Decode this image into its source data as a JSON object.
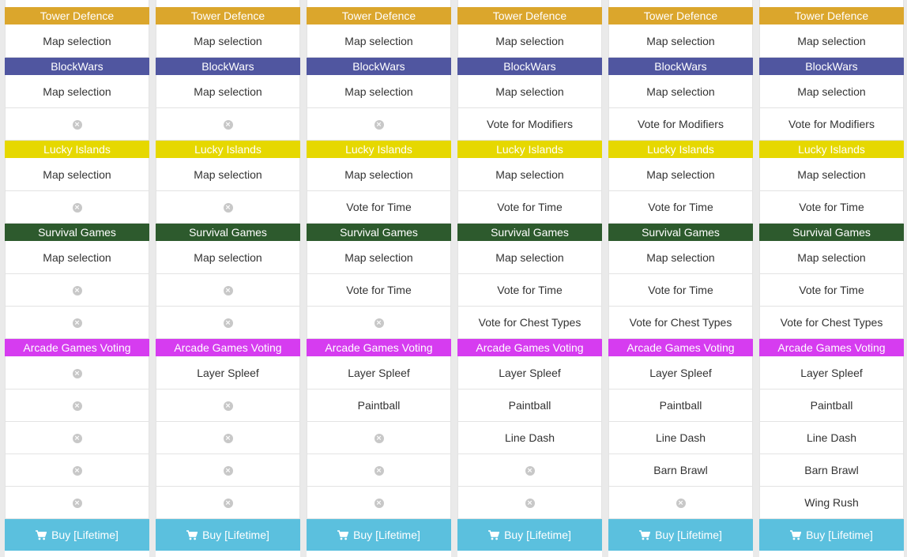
{
  "colors": {
    "tower_defence": "#dba62c",
    "blockwars": "#5056a0",
    "lucky_islands": "#e6d800",
    "survival_games": "#2d5a2d",
    "arcade_games_voting": "#d63cf0",
    "buy": "#5bc0de"
  },
  "buy_label": "Buy [Lifetime]",
  "columns": [
    {
      "tower_defence": {
        "title": "Tower Defence",
        "cells": [
          "Map selection"
        ]
      },
      "blockwars": {
        "title": "BlockWars",
        "cells": [
          "Map selection",
          null
        ]
      },
      "lucky_islands": {
        "title": "Lucky Islands",
        "cells": [
          "Map selection",
          null
        ]
      },
      "survival_games": {
        "title": "Survival Games",
        "cells": [
          "Map selection",
          null,
          null
        ]
      },
      "arcade_games_voting": {
        "title": "Arcade Games Voting",
        "cells": [
          null,
          null,
          null,
          null,
          null
        ]
      }
    },
    {
      "tower_defence": {
        "title": "Tower Defence",
        "cells": [
          "Map selection"
        ]
      },
      "blockwars": {
        "title": "BlockWars",
        "cells": [
          "Map selection",
          null
        ]
      },
      "lucky_islands": {
        "title": "Lucky Islands",
        "cells": [
          "Map selection",
          null
        ]
      },
      "survival_games": {
        "title": "Survival Games",
        "cells": [
          "Map selection",
          null,
          null
        ]
      },
      "arcade_games_voting": {
        "title": "Arcade Games Voting",
        "cells": [
          "Layer Spleef",
          null,
          null,
          null,
          null
        ]
      }
    },
    {
      "tower_defence": {
        "title": "Tower Defence",
        "cells": [
          "Map selection"
        ]
      },
      "blockwars": {
        "title": "BlockWars",
        "cells": [
          "Map selection",
          null
        ]
      },
      "lucky_islands": {
        "title": "Lucky Islands",
        "cells": [
          "Map selection",
          "Vote for Time"
        ]
      },
      "survival_games": {
        "title": "Survival Games",
        "cells": [
          "Map selection",
          "Vote for Time",
          null
        ]
      },
      "arcade_games_voting": {
        "title": "Arcade Games Voting",
        "cells": [
          "Layer Spleef",
          "Paintball",
          null,
          null,
          null
        ]
      }
    },
    {
      "tower_defence": {
        "title": "Tower Defence",
        "cells": [
          "Map selection"
        ]
      },
      "blockwars": {
        "title": "BlockWars",
        "cells": [
          "Map selection",
          "Vote for Modifiers"
        ]
      },
      "lucky_islands": {
        "title": "Lucky Islands",
        "cells": [
          "Map selection",
          "Vote for Time"
        ]
      },
      "survival_games": {
        "title": "Survival Games",
        "cells": [
          "Map selection",
          "Vote for Time",
          "Vote for Chest Types"
        ]
      },
      "arcade_games_voting": {
        "title": "Arcade Games Voting",
        "cells": [
          "Layer Spleef",
          "Paintball",
          "Line Dash",
          null,
          null
        ]
      }
    },
    {
      "tower_defence": {
        "title": "Tower Defence",
        "cells": [
          "Map selection"
        ]
      },
      "blockwars": {
        "title": "BlockWars",
        "cells": [
          "Map selection",
          "Vote for Modifiers"
        ]
      },
      "lucky_islands": {
        "title": "Lucky Islands",
        "cells": [
          "Map selection",
          "Vote for Time"
        ]
      },
      "survival_games": {
        "title": "Survival Games",
        "cells": [
          "Map selection",
          "Vote for Time",
          "Vote for Chest Types"
        ]
      },
      "arcade_games_voting": {
        "title": "Arcade Games Voting",
        "cells": [
          "Layer Spleef",
          "Paintball",
          "Line Dash",
          "Barn Brawl",
          null
        ]
      }
    },
    {
      "tower_defence": {
        "title": "Tower Defence",
        "cells": [
          "Map selection"
        ]
      },
      "blockwars": {
        "title": "BlockWars",
        "cells": [
          "Map selection",
          "Vote for Modifiers"
        ]
      },
      "lucky_islands": {
        "title": "Lucky Islands",
        "cells": [
          "Map selection",
          "Vote for Time"
        ]
      },
      "survival_games": {
        "title": "Survival Games",
        "cells": [
          "Map selection",
          "Vote for Time",
          "Vote for Chest Types"
        ]
      },
      "arcade_games_voting": {
        "title": "Arcade Games Voting",
        "cells": [
          "Layer Spleef",
          "Paintball",
          "Line Dash",
          "Barn Brawl",
          "Wing Rush"
        ]
      }
    }
  ]
}
